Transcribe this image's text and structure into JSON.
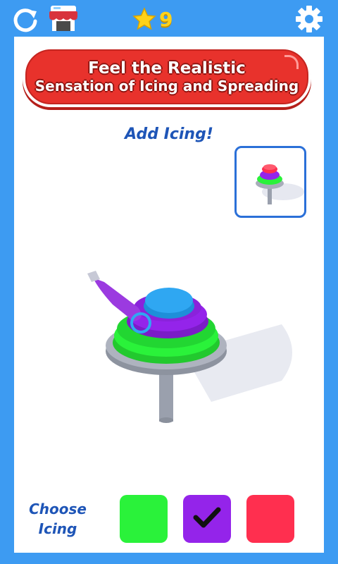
{
  "header": {
    "stars_count": "9",
    "icons": [
      "restart-icon",
      "shop-icon",
      "star-icon",
      "gear-icon"
    ]
  },
  "banner": {
    "line1": "Feel the Realistic",
    "line2": "Sensation of Icing and Spreading"
  },
  "game": {
    "instruction": "Add Icing!"
  },
  "icing_picker": {
    "label_line1": "Choose",
    "label_line2": "Icing",
    "options": [
      {
        "name": "green",
        "color": "#2af23a",
        "selected": false
      },
      {
        "name": "purple",
        "color": "#9424ea",
        "selected": true
      },
      {
        "name": "red",
        "color": "#ff2f4f",
        "selected": false
      }
    ]
  },
  "colors": {
    "background": "#3d9bf2",
    "accent_blue": "#1e55b7",
    "banner_red": "#e8322c",
    "star_yellow": "#ffd21a"
  }
}
